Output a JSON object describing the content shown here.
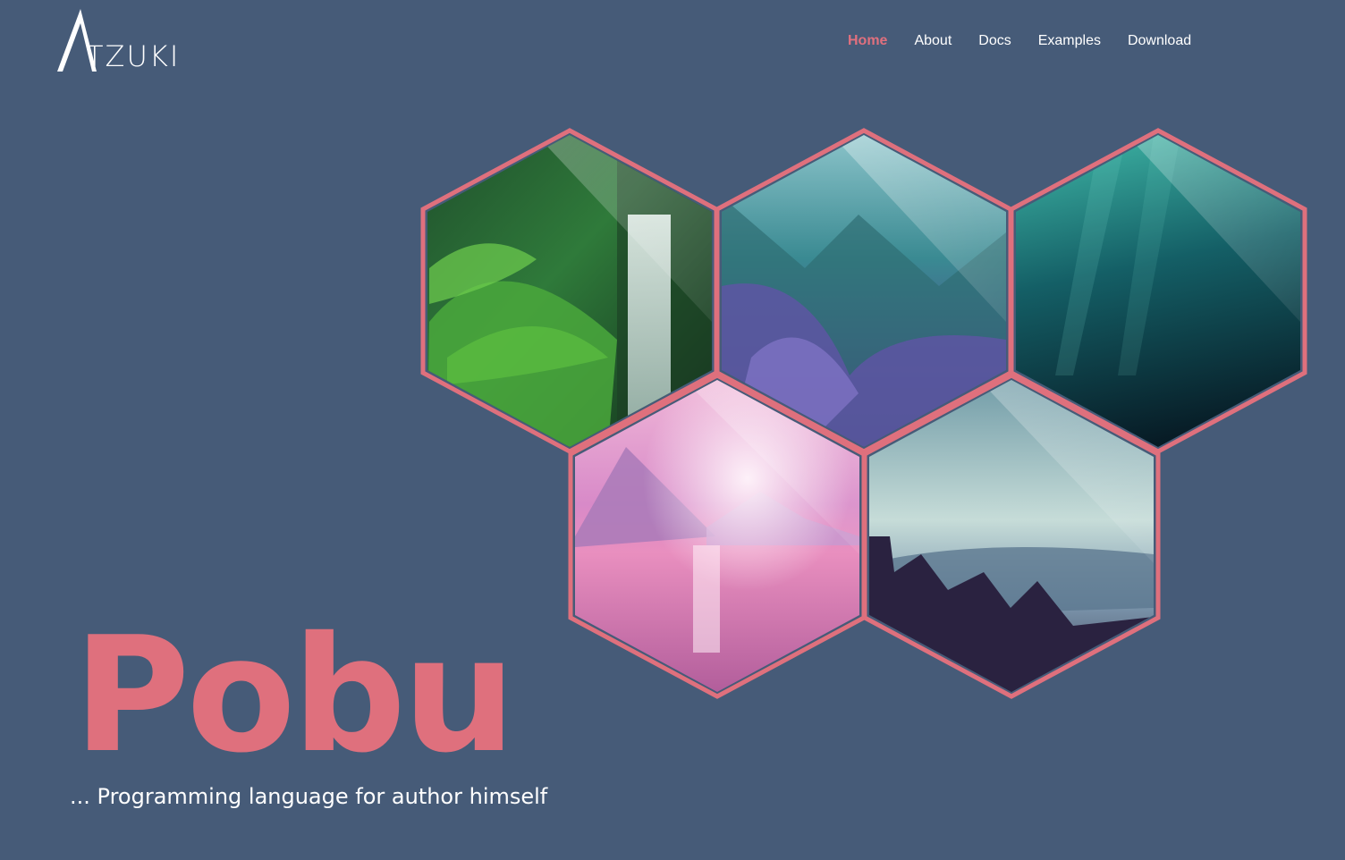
{
  "brand": {
    "logo_text": "TZUKI",
    "logo_icon": "a-mountain-icon"
  },
  "nav": {
    "items": [
      {
        "label": "Home",
        "active": true
      },
      {
        "label": "About",
        "active": false
      },
      {
        "label": "Docs",
        "active": false
      },
      {
        "label": "Examples",
        "active": false
      },
      {
        "label": "Download",
        "active": false
      }
    ]
  },
  "gallery": {
    "tiles": [
      {
        "name": "forest-waterfall"
      },
      {
        "name": "misty-valley"
      },
      {
        "name": "deep-underwater"
      },
      {
        "name": "pink-lake-sunset"
      },
      {
        "name": "pine-forest-mountains"
      }
    ]
  },
  "hero": {
    "title": "Pobu",
    "subtitle": "... Programming language for author himself"
  },
  "colors": {
    "background": "#465b78",
    "accent": "#df707d",
    "text": "#ffffff"
  }
}
